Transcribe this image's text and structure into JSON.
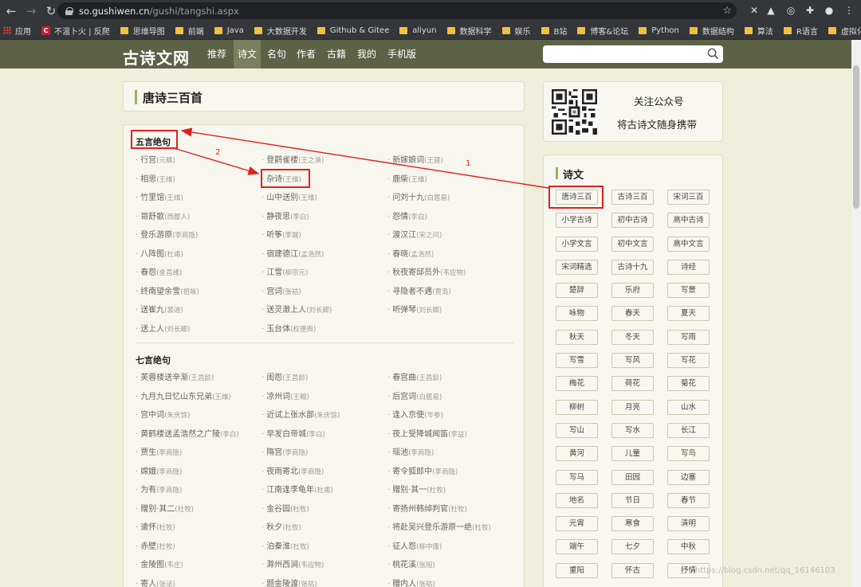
{
  "browser": {
    "url_host": "so.gushiwen.cn",
    "url_path": "/gushi/tangshi.aspx"
  },
  "bookmarks": [
    "应用",
    "不温卜火 | 反爬",
    "思维导图",
    "前端",
    "Java",
    "大数据开发",
    "Github & Gitee",
    "aliyun",
    "数据科学",
    "娱乐",
    "B站",
    "博客&论坛",
    "Python",
    "数据结构",
    "算法",
    "R语言",
    "虚拟化"
  ],
  "site": {
    "logo": "古诗文网",
    "nav": [
      "推荐",
      "诗文",
      "名句",
      "作者",
      "古籍",
      "我的",
      "手机版"
    ]
  },
  "page_title": "唐诗三百首",
  "wuyan": {
    "heading": "五言绝句",
    "cols": [
      [
        [
          "行宫",
          "(元稹)"
        ],
        [
          "相思",
          "(王维)"
        ],
        [
          "竹里馆",
          "(王维)"
        ],
        [
          "哥舒歌",
          "(西鄙人)"
        ],
        [
          "登乐游原",
          "(李商隐)"
        ],
        [
          "八阵图",
          "(杜甫)"
        ],
        [
          "春怨",
          "(金昌绪)"
        ],
        [
          "终南望余雪",
          "(祖咏)"
        ],
        [
          "送崔九",
          "(裴迪)"
        ],
        [
          "送上人",
          "(刘长卿)"
        ]
      ],
      [
        [
          "登鹳雀楼",
          "(王之涣)"
        ],
        [
          "杂诗",
          "(王维)"
        ],
        [
          "山中送别",
          "(王维)"
        ],
        [
          "静夜思",
          "(李白)"
        ],
        [
          "听筝",
          "(李端)"
        ],
        [
          "宿建德江",
          "(孟浩然)"
        ],
        [
          "江雪",
          "(柳宗元)"
        ],
        [
          "宫词",
          "(张祜)"
        ],
        [
          "送灵澈上人",
          "(刘长卿)"
        ],
        [
          "玉台体",
          "(权德舆)"
        ]
      ],
      [
        [
          "新嫁娘词",
          "(王建)"
        ],
        [
          "鹿柴",
          "(王维)"
        ],
        [
          "问刘十九",
          "(白居易)"
        ],
        [
          "怨情",
          "(李白)"
        ],
        [
          "渡汉江",
          "(宋之问)"
        ],
        [
          "春晓",
          "(孟浩然)"
        ],
        [
          "秋夜寄邱员外",
          "(韦应物)"
        ],
        [
          "寻隐者不遇",
          "(贾岛)"
        ],
        [
          "听弹琴",
          "(刘长卿)"
        ]
      ]
    ]
  },
  "qiyan": {
    "heading": "七言绝句",
    "cols": [
      [
        [
          "芙蓉楼送辛渐",
          "(王昌龄)"
        ],
        [
          "九月九日忆山东兄弟",
          "(王维)"
        ],
        [
          "宫中词",
          "(朱庆馀)"
        ],
        [
          "黄鹤楼送孟浩然之广陵",
          "(李白)"
        ],
        [
          "贾生",
          "(李商隐)"
        ],
        [
          "嫦娥",
          "(李商隐)"
        ],
        [
          "为有",
          "(李商隐)"
        ],
        [
          "赠别·其二",
          "(杜牧)"
        ],
        [
          "遣怀",
          "(杜牧)"
        ],
        [
          "赤壁",
          "(杜牧)"
        ],
        [
          "金陵图",
          "(韦庄)"
        ],
        [
          "寄人",
          "(张泌)"
        ]
      ],
      [
        [
          "闺怨",
          "(王昌龄)"
        ],
        [
          "凉州词",
          "(王翰)"
        ],
        [
          "近试上张水部",
          "(朱庆馀)"
        ],
        [
          "早发白帝城",
          "(李白)"
        ],
        [
          "隋宫",
          "(李商隐)"
        ],
        [
          "夜雨寄北",
          "(李商隐)"
        ],
        [
          "江南逢李龟年",
          "(杜甫)"
        ],
        [
          "金谷园",
          "(杜牧)"
        ],
        [
          "秋夕",
          "(杜牧)"
        ],
        [
          "泊秦淮",
          "(杜牧)"
        ],
        [
          "滁州西涧",
          "(韦应物)"
        ],
        [
          "题金陵渡",
          "(张祜)"
        ]
      ],
      [
        [
          "春宫曲",
          "(王昌龄)"
        ],
        [
          "后宫词",
          "(白居易)"
        ],
        [
          "逢入京使",
          "(岑参)"
        ],
        [
          "夜上受降城闻笛",
          "(李益)"
        ],
        [
          "瑶池",
          "(李商隐)"
        ],
        [
          "寄令狐郎中",
          "(李商隐)"
        ],
        [
          "赠别·其一",
          "(杜牧)"
        ],
        [
          "寄扬州韩绰判官",
          "(杜牧)"
        ],
        [
          "将赴吴兴登乐游原一绝",
          "(杜牧)"
        ],
        [
          "征人怨",
          "(柳中庸)"
        ],
        [
          "桃花溪",
          "(张旭)"
        ],
        [
          "赠内人",
          "(张祜)"
        ]
      ]
    ]
  },
  "sidebar": {
    "follow_title": "关注公众号",
    "follow_sub": "将古诗文随身携带",
    "section": "诗文",
    "tags": [
      "唐诗三百",
      "古诗三百",
      "宋词三百",
      "小学古诗",
      "初中古诗",
      "高中古诗",
      "小学文言",
      "初中文言",
      "高中文言",
      "宋词精选",
      "古诗十九",
      "诗经",
      "楚辞",
      "乐府",
      "写景",
      "咏物",
      "春天",
      "夏天",
      "秋天",
      "冬天",
      "写雨",
      "写雪",
      "写风",
      "写花",
      "梅花",
      "荷花",
      "菊花",
      "柳树",
      "月亮",
      "山水",
      "写山",
      "写水",
      "长江",
      "黄河",
      "儿童",
      "写鸟",
      "写马",
      "田园",
      "边塞",
      "地名",
      "节日",
      "春节",
      "元宵",
      "寒食",
      "清明",
      "端午",
      "七夕",
      "中秋",
      "重阳",
      "怀古",
      "抒情"
    ]
  },
  "annotations": {
    "one": "1",
    "two": "2"
  },
  "watermark": "https://blog.csdn.net/qq_16146103",
  "colors": {
    "nav_bg": "#5d6146",
    "page_bg": "#efefdc",
    "highlight": "#e02020",
    "accent": "#9bb25a"
  }
}
